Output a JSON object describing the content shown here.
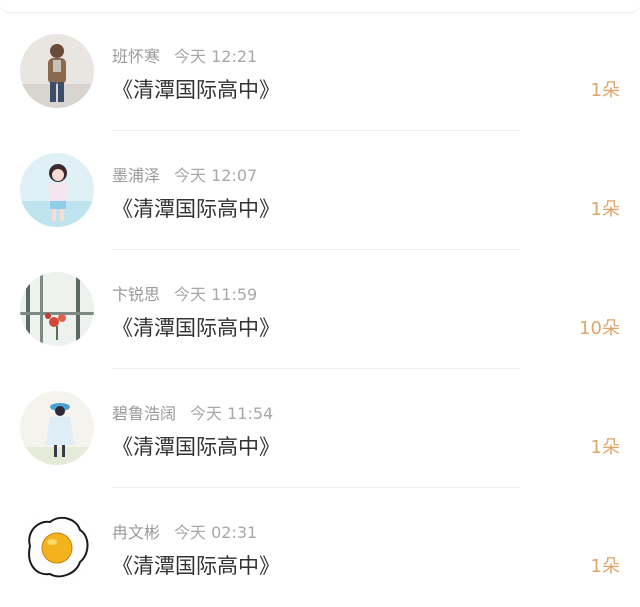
{
  "messages": [
    {
      "user": "班怀寒",
      "time": "今天 12:21",
      "title": "《清潭国际高中》",
      "count": "1朵",
      "avatar_icon": "person-avatar"
    },
    {
      "user": "墨浦泽",
      "time": "今天 12:07",
      "title": "《清潭国际高中》",
      "count": "1朵",
      "avatar_icon": "anime-girl-avatar"
    },
    {
      "user": "卞锐思",
      "time": "今天 11:59",
      "title": "《清潭国际高中》",
      "count": "10朵",
      "avatar_icon": "flower-window-avatar"
    },
    {
      "user": "碧鲁浩阔",
      "time": "今天 11:54",
      "title": "《清潭国际高中》",
      "count": "1朵",
      "avatar_icon": "girl-hat-avatar"
    },
    {
      "user": "冉文彬",
      "time": "今天 02:31",
      "title": "《清潭国际高中》",
      "count": "1朵",
      "avatar_icon": "fried-egg-avatar"
    }
  ],
  "colors": {
    "count_accent": "#e0a56a",
    "meta_gray": "#9a9a9a",
    "title_dark": "#333333"
  }
}
